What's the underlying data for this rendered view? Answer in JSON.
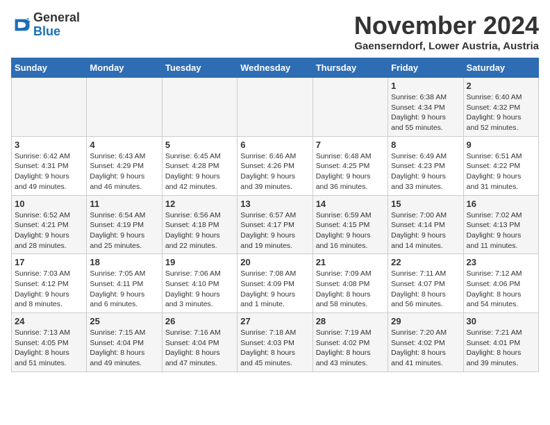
{
  "logo": {
    "general": "General",
    "blue": "Blue"
  },
  "header": {
    "month": "November 2024",
    "location": "Gaenserndorf, Lower Austria, Austria"
  },
  "weekdays": [
    "Sunday",
    "Monday",
    "Tuesday",
    "Wednesday",
    "Thursday",
    "Friday",
    "Saturday"
  ],
  "weeks": [
    [
      {
        "day": "",
        "info": ""
      },
      {
        "day": "",
        "info": ""
      },
      {
        "day": "",
        "info": ""
      },
      {
        "day": "",
        "info": ""
      },
      {
        "day": "",
        "info": ""
      },
      {
        "day": "1",
        "info": "Sunrise: 6:38 AM\nSunset: 4:34 PM\nDaylight: 9 hours\nand 55 minutes."
      },
      {
        "day": "2",
        "info": "Sunrise: 6:40 AM\nSunset: 4:32 PM\nDaylight: 9 hours\nand 52 minutes."
      }
    ],
    [
      {
        "day": "3",
        "info": "Sunrise: 6:42 AM\nSunset: 4:31 PM\nDaylight: 9 hours\nand 49 minutes."
      },
      {
        "day": "4",
        "info": "Sunrise: 6:43 AM\nSunset: 4:29 PM\nDaylight: 9 hours\nand 46 minutes."
      },
      {
        "day": "5",
        "info": "Sunrise: 6:45 AM\nSunset: 4:28 PM\nDaylight: 9 hours\nand 42 minutes."
      },
      {
        "day": "6",
        "info": "Sunrise: 6:46 AM\nSunset: 4:26 PM\nDaylight: 9 hours\nand 39 minutes."
      },
      {
        "day": "7",
        "info": "Sunrise: 6:48 AM\nSunset: 4:25 PM\nDaylight: 9 hours\nand 36 minutes."
      },
      {
        "day": "8",
        "info": "Sunrise: 6:49 AM\nSunset: 4:23 PM\nDaylight: 9 hours\nand 33 minutes."
      },
      {
        "day": "9",
        "info": "Sunrise: 6:51 AM\nSunset: 4:22 PM\nDaylight: 9 hours\nand 31 minutes."
      }
    ],
    [
      {
        "day": "10",
        "info": "Sunrise: 6:52 AM\nSunset: 4:21 PM\nDaylight: 9 hours\nand 28 minutes."
      },
      {
        "day": "11",
        "info": "Sunrise: 6:54 AM\nSunset: 4:19 PM\nDaylight: 9 hours\nand 25 minutes."
      },
      {
        "day": "12",
        "info": "Sunrise: 6:56 AM\nSunset: 4:18 PM\nDaylight: 9 hours\nand 22 minutes."
      },
      {
        "day": "13",
        "info": "Sunrise: 6:57 AM\nSunset: 4:17 PM\nDaylight: 9 hours\nand 19 minutes."
      },
      {
        "day": "14",
        "info": "Sunrise: 6:59 AM\nSunset: 4:15 PM\nDaylight: 9 hours\nand 16 minutes."
      },
      {
        "day": "15",
        "info": "Sunrise: 7:00 AM\nSunset: 4:14 PM\nDaylight: 9 hours\nand 14 minutes."
      },
      {
        "day": "16",
        "info": "Sunrise: 7:02 AM\nSunset: 4:13 PM\nDaylight: 9 hours\nand 11 minutes."
      }
    ],
    [
      {
        "day": "17",
        "info": "Sunrise: 7:03 AM\nSunset: 4:12 PM\nDaylight: 9 hours\nand 8 minutes."
      },
      {
        "day": "18",
        "info": "Sunrise: 7:05 AM\nSunset: 4:11 PM\nDaylight: 9 hours\nand 6 minutes."
      },
      {
        "day": "19",
        "info": "Sunrise: 7:06 AM\nSunset: 4:10 PM\nDaylight: 9 hours\nand 3 minutes."
      },
      {
        "day": "20",
        "info": "Sunrise: 7:08 AM\nSunset: 4:09 PM\nDaylight: 9 hours\nand 1 minute."
      },
      {
        "day": "21",
        "info": "Sunrise: 7:09 AM\nSunset: 4:08 PM\nDaylight: 8 hours\nand 58 minutes."
      },
      {
        "day": "22",
        "info": "Sunrise: 7:11 AM\nSunset: 4:07 PM\nDaylight: 8 hours\nand 56 minutes."
      },
      {
        "day": "23",
        "info": "Sunrise: 7:12 AM\nSunset: 4:06 PM\nDaylight: 8 hours\nand 54 minutes."
      }
    ],
    [
      {
        "day": "24",
        "info": "Sunrise: 7:13 AM\nSunset: 4:05 PM\nDaylight: 8 hours\nand 51 minutes."
      },
      {
        "day": "25",
        "info": "Sunrise: 7:15 AM\nSunset: 4:04 PM\nDaylight: 8 hours\nand 49 minutes."
      },
      {
        "day": "26",
        "info": "Sunrise: 7:16 AM\nSunset: 4:04 PM\nDaylight: 8 hours\nand 47 minutes."
      },
      {
        "day": "27",
        "info": "Sunrise: 7:18 AM\nSunset: 4:03 PM\nDaylight: 8 hours\nand 45 minutes."
      },
      {
        "day": "28",
        "info": "Sunrise: 7:19 AM\nSunset: 4:02 PM\nDaylight: 8 hours\nand 43 minutes."
      },
      {
        "day": "29",
        "info": "Sunrise: 7:20 AM\nSunset: 4:02 PM\nDaylight: 8 hours\nand 41 minutes."
      },
      {
        "day": "30",
        "info": "Sunrise: 7:21 AM\nSunset: 4:01 PM\nDaylight: 8 hours\nand 39 minutes."
      }
    ]
  ]
}
